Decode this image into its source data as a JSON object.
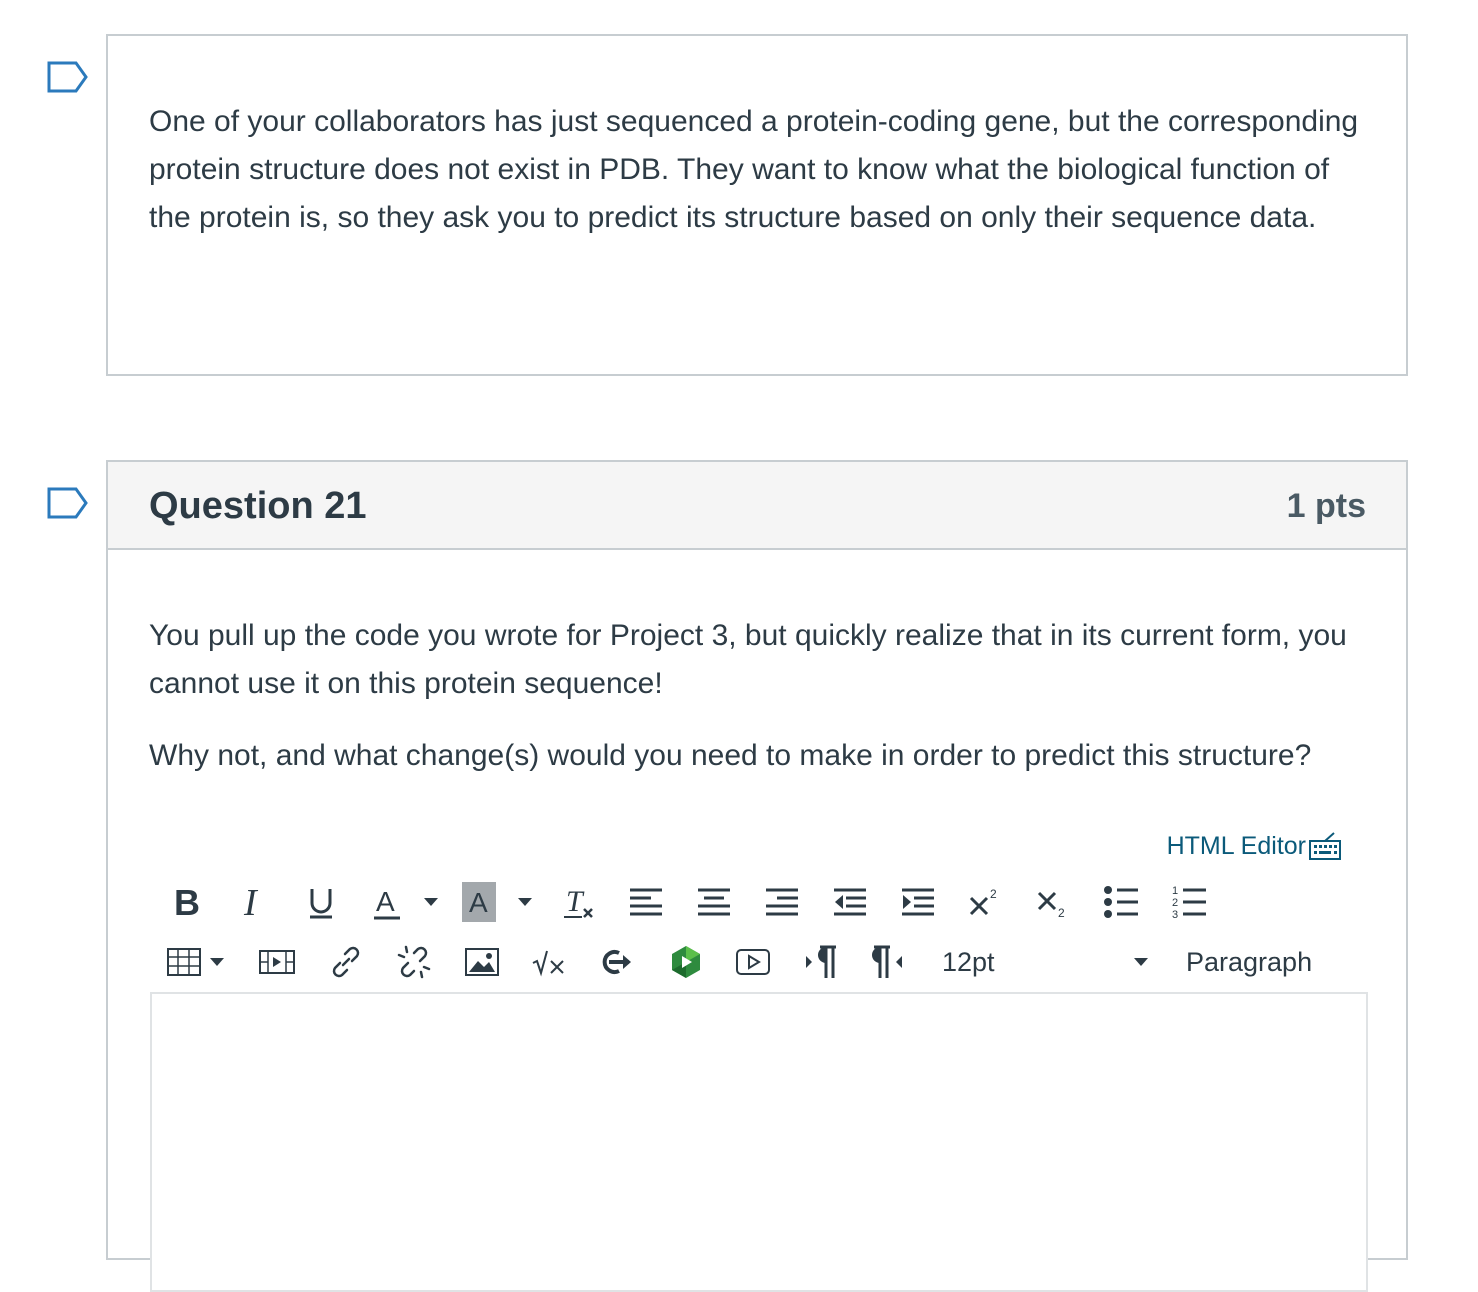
{
  "previous_question": {
    "text": "One of your collaborators has just sequenced a protein-coding gene, but the corresponding protein structure does not exist in PDB. They want to know what the biological function of the protein is, so they ask you to predict its structure based on only their sequence data."
  },
  "question": {
    "title": "Question 21",
    "points": "1 pts",
    "paragraph_1": "You pull up the code you wrote for Project 3, but quickly realize that in its current form, you cannot use it on this protein sequence!",
    "paragraph_2": "Why not, and what change(s) would you need to make in order to predict this structure?"
  },
  "editor": {
    "html_editor_label": "HTML Editor",
    "font_size": "12pt",
    "block_format": "Paragraph",
    "toolbar_row_1": [
      "bold-icon",
      "italic-icon",
      "underline-icon",
      "text-color-icon",
      "background-color-icon",
      "clear-formatting-icon",
      "align-left-icon",
      "align-center-icon",
      "align-right-icon",
      "outdent-icon",
      "indent-icon",
      "superscript-icon",
      "subscript-icon",
      "bullet-list-icon",
      "numbered-list-icon"
    ],
    "toolbar_row_2": [
      "table-icon",
      "media-icon",
      "link-icon",
      "unlink-icon",
      "image-icon",
      "equation-icon",
      "embed-icon",
      "apps-icon",
      "video-icon",
      "ltr-icon",
      "rtl-icon"
    ]
  },
  "colors": {
    "text": "#2d3b45",
    "border": "#c7cdd1",
    "header_bg": "#f5f5f5",
    "link": "#0b5a7a",
    "flag": "#2b7abc"
  }
}
